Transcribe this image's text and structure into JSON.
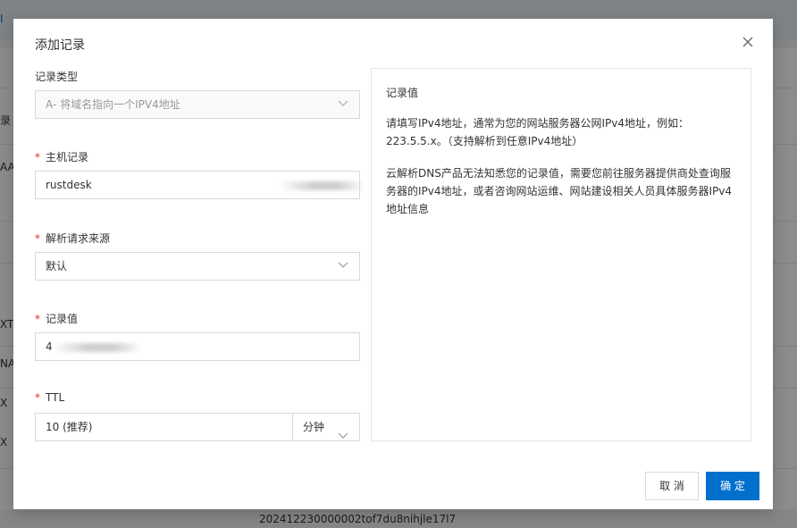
{
  "background": {
    "top_mark": "I",
    "row_fragments": [
      "录",
      "AA",
      "XT",
      "NA",
      "X",
      "X"
    ],
    "footer_id": "202412230000002tof7du8nihjle17l7"
  },
  "dialog": {
    "title": "添加记录",
    "record_type": {
      "label": "记录类型",
      "value": "A- 将域名指向一个IPV4地址"
    },
    "host_record": {
      "label": "主机记录",
      "value": "rustdesk"
    },
    "resolve_source": {
      "label": "解析请求来源",
      "value": "默认"
    },
    "record_value": {
      "label": "记录值",
      "value": "4"
    },
    "ttl": {
      "label": "TTL",
      "value": "10 (推荐)",
      "unit": "分钟"
    },
    "help": {
      "title": "记录值",
      "p1": "请填写IPv4地址，通常为您的网站服务器公网IPv4地址，例如：223.5.5.x。（支持解析到任意IPv4地址）",
      "p2": "云解析DNS产品无法知悉您的记录值，需要您前往服务器提供商处查询服务器的IPv4地址，或者咨询网站运维、网站建设相关人员具体服务器IPv4地址信息"
    },
    "buttons": {
      "cancel": "取 消",
      "ok": "确 定"
    }
  },
  "colors": {
    "primary": "#0070cc",
    "required": "#d93026"
  }
}
